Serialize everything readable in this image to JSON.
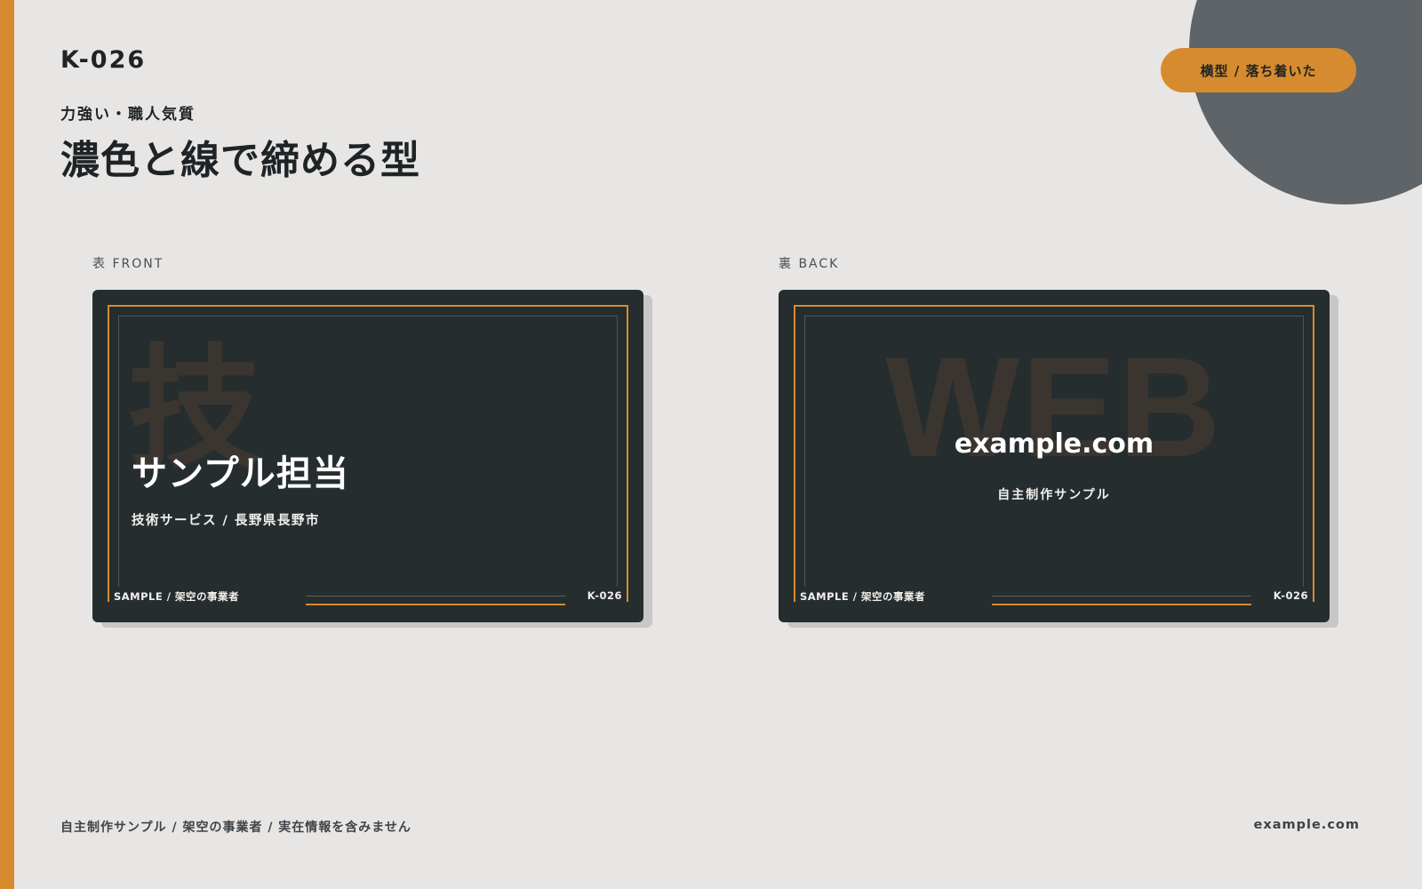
{
  "header": {
    "code": "K-026",
    "subtitle": "力強い・職人気質",
    "title": "濃色と線で締める型",
    "tag": "横型 / 落ち着いた"
  },
  "front": {
    "label": "表 FRONT",
    "bg_char": "技",
    "name": "サンプル担当",
    "dept": "技術サービス / 長野県長野市",
    "footer_left": "SAMPLE / 架空の事業者",
    "footer_right": "K-026"
  },
  "back": {
    "label": "裏 BACK",
    "bg_word": "WEB",
    "url": "example.com",
    "tagline": "自主制作サンプル",
    "footer_left": "SAMPLE / 架空の事業者",
    "footer_right": "K-026"
  },
  "footer": {
    "note": "自主制作サンプル / 架空の事業者 / 実在情報を含みません",
    "url": "example.com"
  },
  "colors": {
    "accent": "#d68c2e",
    "background": "#e8e6e4",
    "card": "#262d2f",
    "circle": "#5f6468"
  }
}
